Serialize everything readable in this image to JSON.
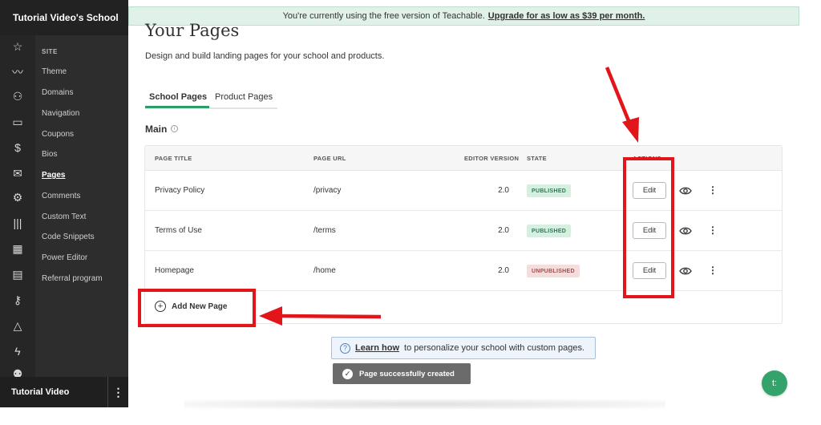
{
  "sidebar": {
    "school_name": "Tutorial Video's School",
    "section_label": "SITE",
    "items": [
      {
        "label": "Theme"
      },
      {
        "label": "Domains"
      },
      {
        "label": "Navigation"
      },
      {
        "label": "Coupons"
      },
      {
        "label": "Bios"
      },
      {
        "label": "Pages",
        "active": true
      },
      {
        "label": "Comments"
      },
      {
        "label": "Custom Text"
      },
      {
        "label": "Code Snippets"
      },
      {
        "label": "Power Editor"
      },
      {
        "label": "Referral program"
      }
    ],
    "rail_icons": [
      "star-icon",
      "trend-icon",
      "users-icon",
      "devices-icon",
      "dollar-icon",
      "mail-icon",
      "gear-icon",
      "library-icon",
      "calendar-icon",
      "report-icon",
      "key-icon",
      "shapes-icon",
      "bolt-icon",
      "team-icon"
    ],
    "footer_label": "Tutorial Video",
    "footer_menu": "⋮"
  },
  "banner": {
    "text": "You're currently using the free version of Teachable.",
    "link": "Upgrade for as low as $39 per month."
  },
  "main": {
    "title": "Your Pages",
    "description": "Design and build landing pages for your school and products.",
    "tabs": [
      {
        "label": "School Pages",
        "active": true
      },
      {
        "label": "Product Pages"
      }
    ],
    "section_title": "Main",
    "columns": [
      "PAGE TITLE",
      "PAGE URL",
      "EDITOR VERSION",
      "STATE",
      "ACTIONS"
    ],
    "rows": [
      {
        "title": "Privacy Policy",
        "url": "/privacy",
        "version": "2.0",
        "state": "PUBLISHED",
        "edit": "Edit"
      },
      {
        "title": "Terms of Use",
        "url": "/terms",
        "version": "2.0",
        "state": "PUBLISHED",
        "edit": "Edit"
      },
      {
        "title": "Homepage",
        "url": "/home",
        "version": "2.0",
        "state": "UNPUBLISHED",
        "edit": "Edit"
      }
    ],
    "add_page_label": "Add New Page",
    "info_link": "Learn how",
    "info_text": "to personalize your school with custom pages.",
    "toast": "Page successfully created",
    "chat_label": "t:"
  },
  "colors": {
    "accent": "#2f9a6a",
    "annotation": "#e1151a",
    "sidebar_bg": "#2d2d2d"
  }
}
